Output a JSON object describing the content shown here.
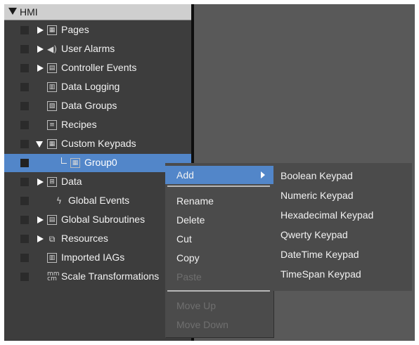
{
  "tree": {
    "root_label": "HMI",
    "items": [
      {
        "label": "Pages",
        "icon": "pages-icon"
      },
      {
        "label": "User Alarms",
        "icon": "speaker-icon"
      },
      {
        "label": "Controller Events",
        "icon": "controller-events-icon"
      },
      {
        "label": "Data Logging",
        "icon": "data-logging-icon"
      },
      {
        "label": "Data Groups",
        "icon": "data-groups-icon"
      },
      {
        "label": "Recipes",
        "icon": "recipes-icon"
      },
      {
        "label": "Custom Keypads",
        "icon": "keypad-icon"
      },
      {
        "label": "Group0",
        "icon": "keypad-group-icon"
      },
      {
        "label": "Data",
        "icon": "data-icon"
      },
      {
        "label": "Global Events",
        "icon": "lightning-icon"
      },
      {
        "label": "Global Subroutines",
        "icon": "subroutine-icon"
      },
      {
        "label": "Resources",
        "icon": "resources-icon"
      },
      {
        "label": "Imported IAGs",
        "icon": "iag-icon"
      },
      {
        "label": "Scale Transformations",
        "icon": "scale-icon"
      }
    ]
  },
  "context_menu": {
    "items": [
      {
        "label": "Add",
        "enabled": true
      },
      {
        "label": "Rename",
        "enabled": true
      },
      {
        "label": "Delete",
        "enabled": true
      },
      {
        "label": "Cut",
        "enabled": true
      },
      {
        "label": "Copy",
        "enabled": true
      },
      {
        "label": "Paste",
        "enabled": false
      },
      {
        "label": "Move Up",
        "enabled": false
      },
      {
        "label": "Move Down",
        "enabled": false
      }
    ]
  },
  "submenu": {
    "items": [
      {
        "label": "Boolean Keypad"
      },
      {
        "label": "Numeric Keypad"
      },
      {
        "label": "Hexadecimal Keypad"
      },
      {
        "label": "Qwerty Keypad"
      },
      {
        "label": "DateTime Keypad"
      },
      {
        "label": "TimeSpan Keypad"
      }
    ]
  },
  "colors": {
    "selection": "#5286c9",
    "tree_background": "#3d3d3d",
    "menu_background": "#4b4b4b",
    "workspace": "#595959",
    "root_header": "#cfcfcf"
  }
}
